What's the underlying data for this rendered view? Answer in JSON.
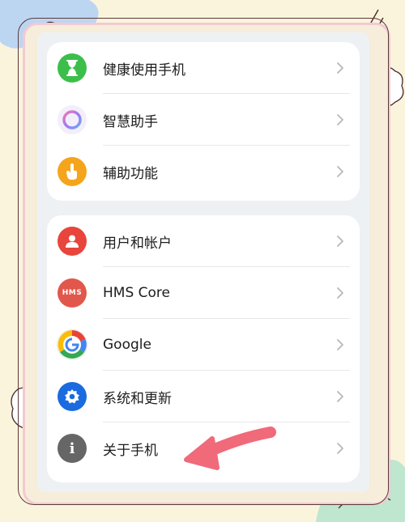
{
  "colors": {
    "background": "#fbf4dc",
    "frame_pink": "#f3c9d3",
    "screen_bg": "#eef1f4",
    "card_bg": "#ffffff",
    "arrow": "#f06a7a"
  },
  "group1": {
    "items": [
      {
        "label": "健康使用手机",
        "icon": "hourglass-icon",
        "color": "#3bbf4a"
      },
      {
        "label": "智慧助手",
        "icon": "assistant-ring-icon",
        "color": "#b47de6"
      },
      {
        "label": "辅助功能",
        "icon": "hand-tap-icon",
        "color": "#f4a51c"
      }
    ]
  },
  "group2": {
    "items": [
      {
        "label": "用户和帐户",
        "icon": "user-icon",
        "color": "#e8453c"
      },
      {
        "label": "HMS Core",
        "icon": "hms-icon",
        "icon_text": "HMS",
        "color": "#e2574c"
      },
      {
        "label": "Google",
        "icon": "google-icon",
        "color": "#ffffff"
      },
      {
        "label": "系统和更新",
        "icon": "gear-icon",
        "color": "#1a6ae0"
      },
      {
        "label": "关于手机",
        "icon": "info-icon",
        "icon_text": "i",
        "color": "#666666"
      }
    ]
  }
}
